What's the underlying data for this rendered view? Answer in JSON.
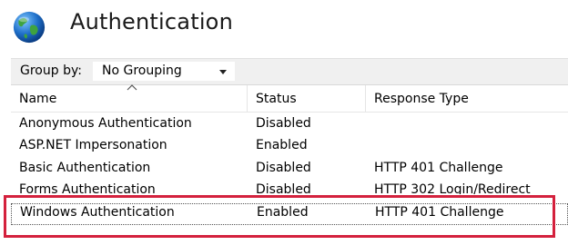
{
  "header": {
    "title": "Authentication",
    "icon": "globe-icon"
  },
  "toolbar": {
    "group_by_label": "Group by:",
    "group_by_value": "No Grouping"
  },
  "table": {
    "columns": [
      "Name",
      "Status",
      "Response Type"
    ],
    "rows": [
      {
        "name": "Anonymous Authentication",
        "status": "Disabled",
        "response": ""
      },
      {
        "name": "ASP.NET Impersonation",
        "status": "Enabled",
        "response": ""
      },
      {
        "name": "Basic Authentication",
        "status": "Disabled",
        "response": "HTTP 401 Challenge"
      },
      {
        "name": "Forms Authentication",
        "status": "Disabled",
        "response": "HTTP 302 Login/Redirect"
      },
      {
        "name": "Windows Authentication",
        "status": "Enabled",
        "response": "HTTP 401 Challenge",
        "selected": true
      }
    ]
  },
  "colors": {
    "highlight": "#d4213d",
    "toolbar_bg": "#f0f0f0"
  }
}
